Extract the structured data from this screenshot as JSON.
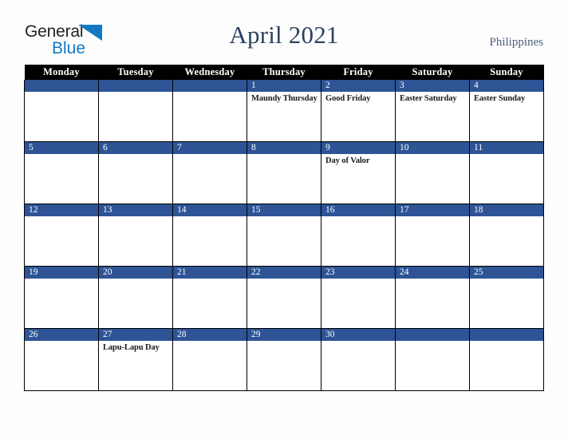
{
  "brand": {
    "name_part1": "General",
    "name_part2": "Blue",
    "triangle_icon": "triangle-icon",
    "accent_color": "#1279c2",
    "text_color": "#231f20"
  },
  "header": {
    "title": "April 2021",
    "country": "Philippines",
    "title_color": "#2b4161",
    "country_color": "#4a5e80"
  },
  "calendar": {
    "month": "April",
    "year": "2021",
    "day_headers": [
      "Monday",
      "Tuesday",
      "Wednesday",
      "Thursday",
      "Friday",
      "Saturday",
      "Sunday"
    ],
    "header_bg": "#000000",
    "daybar_bg": "#2e5496",
    "cell_bg": "#ffffff",
    "border_color": "#000000",
    "weeks": [
      [
        {
          "date": "",
          "event": ""
        },
        {
          "date": "",
          "event": ""
        },
        {
          "date": "",
          "event": ""
        },
        {
          "date": "1",
          "event": "Maundy Thursday"
        },
        {
          "date": "2",
          "event": "Good Friday"
        },
        {
          "date": "3",
          "event": "Easter Saturday"
        },
        {
          "date": "4",
          "event": "Easter Sunday"
        }
      ],
      [
        {
          "date": "5",
          "event": ""
        },
        {
          "date": "6",
          "event": ""
        },
        {
          "date": "7",
          "event": ""
        },
        {
          "date": "8",
          "event": ""
        },
        {
          "date": "9",
          "event": "Day of Valor"
        },
        {
          "date": "10",
          "event": ""
        },
        {
          "date": "11",
          "event": ""
        }
      ],
      [
        {
          "date": "12",
          "event": ""
        },
        {
          "date": "13",
          "event": ""
        },
        {
          "date": "14",
          "event": ""
        },
        {
          "date": "15",
          "event": ""
        },
        {
          "date": "16",
          "event": ""
        },
        {
          "date": "17",
          "event": ""
        },
        {
          "date": "18",
          "event": ""
        }
      ],
      [
        {
          "date": "19",
          "event": ""
        },
        {
          "date": "20",
          "event": ""
        },
        {
          "date": "21",
          "event": ""
        },
        {
          "date": "22",
          "event": ""
        },
        {
          "date": "23",
          "event": ""
        },
        {
          "date": "24",
          "event": ""
        },
        {
          "date": "25",
          "event": ""
        }
      ],
      [
        {
          "date": "26",
          "event": ""
        },
        {
          "date": "27",
          "event": "Lapu-Lapu Day"
        },
        {
          "date": "28",
          "event": ""
        },
        {
          "date": "29",
          "event": ""
        },
        {
          "date": "30",
          "event": ""
        },
        {
          "date": "",
          "event": ""
        },
        {
          "date": "",
          "event": ""
        }
      ]
    ]
  }
}
